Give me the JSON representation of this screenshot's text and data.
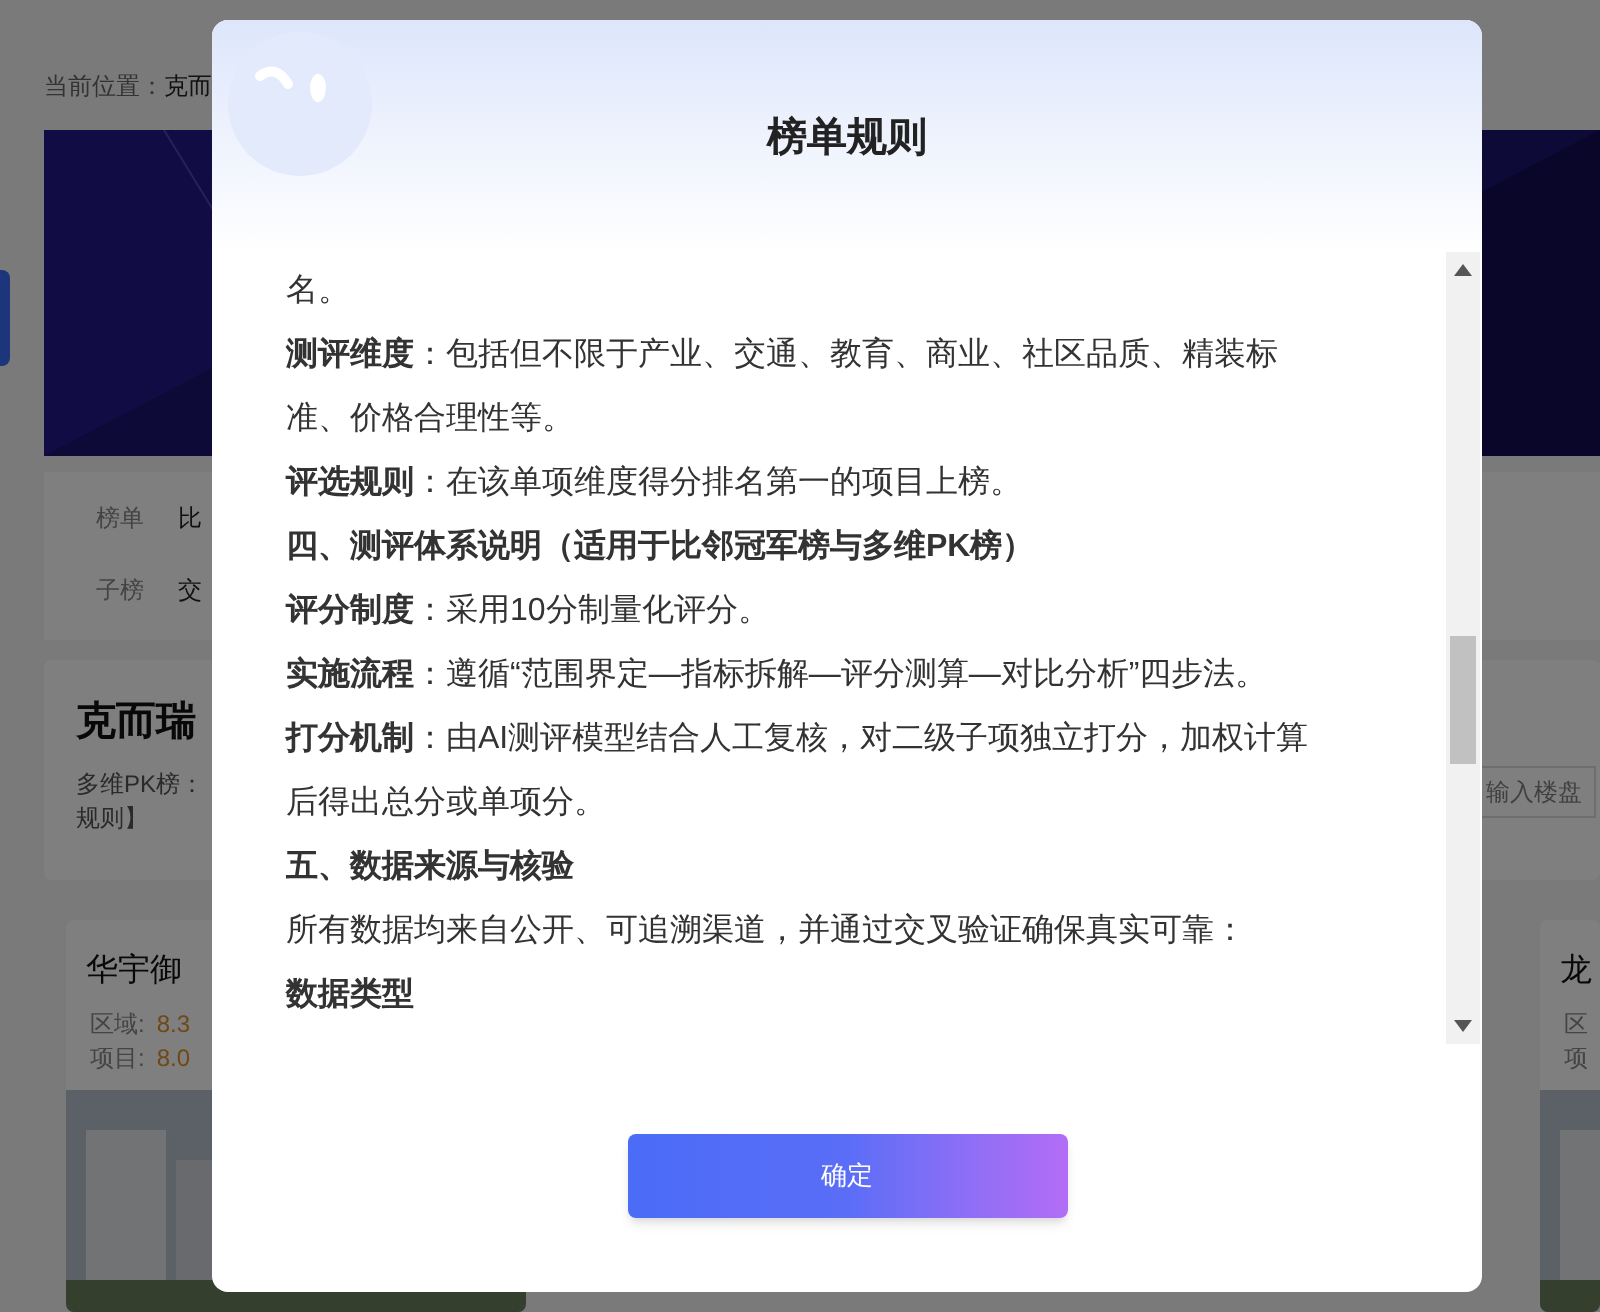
{
  "page": {
    "breadcrumb": {
      "label": "当前位置：",
      "value": "克而"
    },
    "filters": [
      {
        "label": "榜单",
        "value": "比"
      },
      {
        "label": "子榜",
        "value": "交"
      }
    ],
    "heading": "克而瑞",
    "description": [
      "多维PK榜：",
      "规则】"
    ],
    "search": {
      "placeholder": "输入楼盘"
    },
    "cards": [
      {
        "title": "华宇御",
        "scores": [
          {
            "label": "区域:",
            "value": "8.3"
          },
          {
            "label": "项目:",
            "value": "8.0"
          }
        ]
      },
      {
        "title": "龙",
        "scores": [
          {
            "label": "区"
          },
          {
            "label": "项"
          }
        ]
      }
    ]
  },
  "dialog": {
    "title": "榜单规则",
    "paragraphs": [
      {
        "kind": "text",
        "text": "名。"
      },
      {
        "kind": "text",
        "text": "**测评维度**：包括但不限于产业、交通、教育、商业、社区品质、精装标准、价格合理性等。"
      },
      {
        "kind": "text",
        "text": "**评选规则**：在该单项维度得分排名第一的项目上榜。"
      },
      {
        "kind": "heading",
        "text": "四、测评体系说明（适用于比邻冠军榜与多维PK榜）"
      },
      {
        "kind": "text",
        "text": "**评分制度**：采用10分制量化评分。"
      },
      {
        "kind": "text",
        "text": "**实施流程**：遵循“范围界定—指标拆解—评分测算—对比分析”四步法。"
      },
      {
        "kind": "text",
        "text": "**打分机制**：由AI测评模型结合人工复核，对二级子项独立打分，加权计算后得出总分或单项分。"
      },
      {
        "kind": "heading",
        "text": "五、数据来源与核验"
      },
      {
        "kind": "text",
        "text": "所有数据均来自公开、可追溯渠道，并通过交叉验证确保真实可靠："
      },
      {
        "kind": "heading",
        "text": "数据类型"
      }
    ],
    "button": "确定"
  }
}
